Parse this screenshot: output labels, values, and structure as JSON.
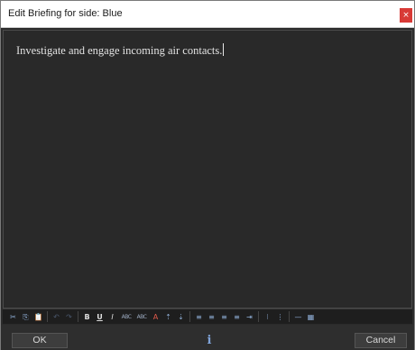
{
  "window": {
    "title": "Edit Briefing for side: Blue",
    "close_glyph": "×"
  },
  "editor": {
    "text": "Investigate and engage incoming air contacts."
  },
  "toolbar": {
    "items": [
      {
        "name": "cut-icon",
        "glyph": "✂"
      },
      {
        "name": "copy-icon",
        "glyph": "⎘"
      },
      {
        "name": "paste-icon",
        "glyph": "📋"
      },
      {
        "name": "undo-icon",
        "glyph": "↶"
      },
      {
        "name": "redo-icon",
        "glyph": "↷"
      },
      {
        "name": "bold-icon",
        "glyph": "B"
      },
      {
        "name": "underline-icon",
        "glyph": "U"
      },
      {
        "name": "italic-icon",
        "glyph": "I"
      },
      {
        "name": "strikethrough-icon",
        "glyph": "ABC"
      },
      {
        "name": "font-size-icon",
        "glyph": "ABC"
      },
      {
        "name": "text-color-icon",
        "glyph": "A"
      },
      {
        "name": "sort-ascending-icon",
        "glyph": "⇡"
      },
      {
        "name": "sort-descending-icon",
        "glyph": "⇣"
      },
      {
        "name": "align-left-icon",
        "glyph": "≡"
      },
      {
        "name": "align-center-icon",
        "glyph": "≡"
      },
      {
        "name": "align-right-icon",
        "glyph": "≡"
      },
      {
        "name": "justify-icon",
        "glyph": "≡"
      },
      {
        "name": "indent-icon",
        "glyph": "⇥"
      },
      {
        "name": "list-icon",
        "glyph": "⁝"
      },
      {
        "name": "bulleted-list-icon",
        "glyph": "⋮"
      },
      {
        "name": "horizontal-rule-icon",
        "glyph": "—"
      },
      {
        "name": "table-icon",
        "glyph": "▦"
      }
    ]
  },
  "footer": {
    "ok_label": "OK",
    "cancel_label": "Cancel",
    "info_glyph": "i"
  },
  "colors": {
    "background": "#2b2b2b",
    "close_button": "#d83a36",
    "text": "#e3e3e3"
  }
}
